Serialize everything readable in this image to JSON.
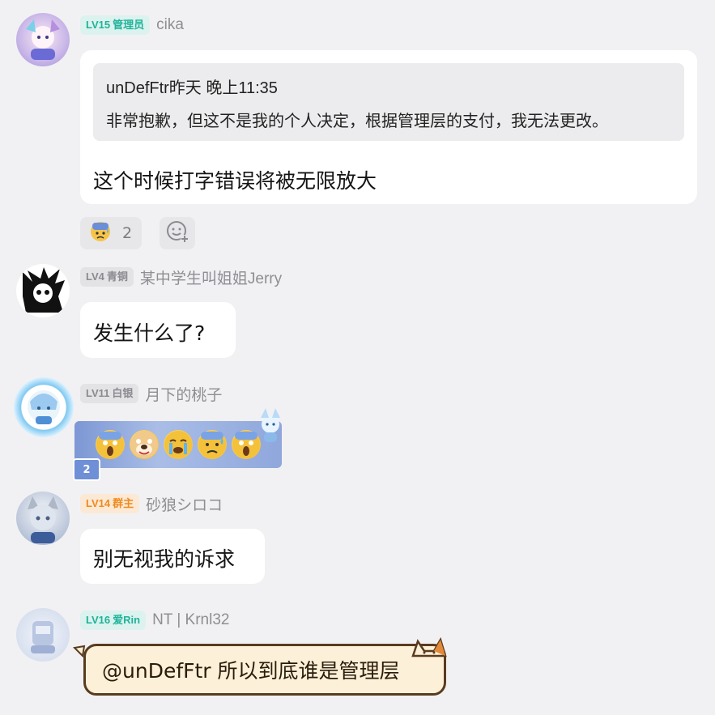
{
  "messages": [
    {
      "badge_level": "LV15",
      "badge_role": "管理员",
      "username": "cika",
      "reply": {
        "header": "unDefFtr昨天 晚上11:35",
        "text": "非常抱歉，但这不是我的个人决定，根据管理层的支付，我无法更改。"
      },
      "text": "这个时候打字错误将被无限放大",
      "reactions": [
        {
          "icon": "anxious-sweat-emoji",
          "count": "2"
        },
        {
          "icon": "add-reaction-icon",
          "count": ""
        }
      ]
    },
    {
      "badge_level": "LV4",
      "badge_role": "青铜",
      "username": "某中学生叫姐姐Jerry",
      "text": "发生什么了?"
    },
    {
      "badge_level": "LV11",
      "badge_role": "白银",
      "username": "月下的桃子",
      "sticker": [
        "scream-emoji",
        "dog-face-emoji",
        "crying-emoji",
        "anxious-sweat-emoji",
        "scream-emoji"
      ],
      "sticker_tag": "2"
    },
    {
      "badge_level": "LV14",
      "badge_role": "群主",
      "username": "砂狼シロコ",
      "text": "别无视我的诉求"
    },
    {
      "badge_level": "LV16",
      "badge_role": "爱Rin",
      "username": "NT | Krnl32",
      "text": "@unDefFtr 所以到底谁是管理层"
    }
  ],
  "colors": {
    "background": "#f1f1f3",
    "badge_teal": "#1fb39a",
    "badge_gray": "#8a8a8f",
    "badge_orange": "#f08a1d"
  }
}
